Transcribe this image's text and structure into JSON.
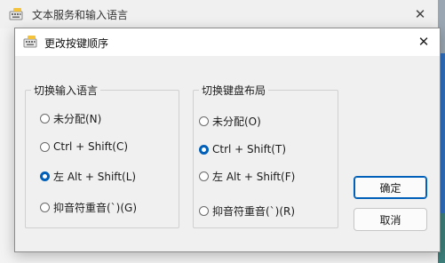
{
  "parent_window": {
    "title": "文本服务和输入语言",
    "icon": "keyboard-icon",
    "close_glyph": "✕"
  },
  "dialog": {
    "title": "更改按键顺序",
    "icon": "keyboard-icon",
    "close_glyph": "✕",
    "switch_input_language": {
      "legend": "切换输入语言",
      "options": [
        {
          "label": "未分配(N)",
          "checked": false
        },
        {
          "label": "Ctrl + Shift(C)",
          "checked": false
        },
        {
          "label": "左 Alt + Shift(L)",
          "checked": true
        },
        {
          "label": "抑音符重音(`)(G)",
          "checked": false
        }
      ]
    },
    "switch_keyboard_layout": {
      "legend": "切换键盘布局",
      "options": [
        {
          "label": "未分配(O)",
          "checked": false
        },
        {
          "label": "Ctrl + Shift(T)",
          "checked": true
        },
        {
          "label": "左 Alt + Shift(F)",
          "checked": false
        },
        {
          "label": "抑音符重音(`)(R)",
          "checked": false
        }
      ]
    },
    "buttons": {
      "ok": "确定",
      "cancel": "取消"
    }
  },
  "colors": {
    "accent": "#005fb8",
    "dialog_bg": "#f0f0f0",
    "titlebar_bg": "#ffffff"
  }
}
